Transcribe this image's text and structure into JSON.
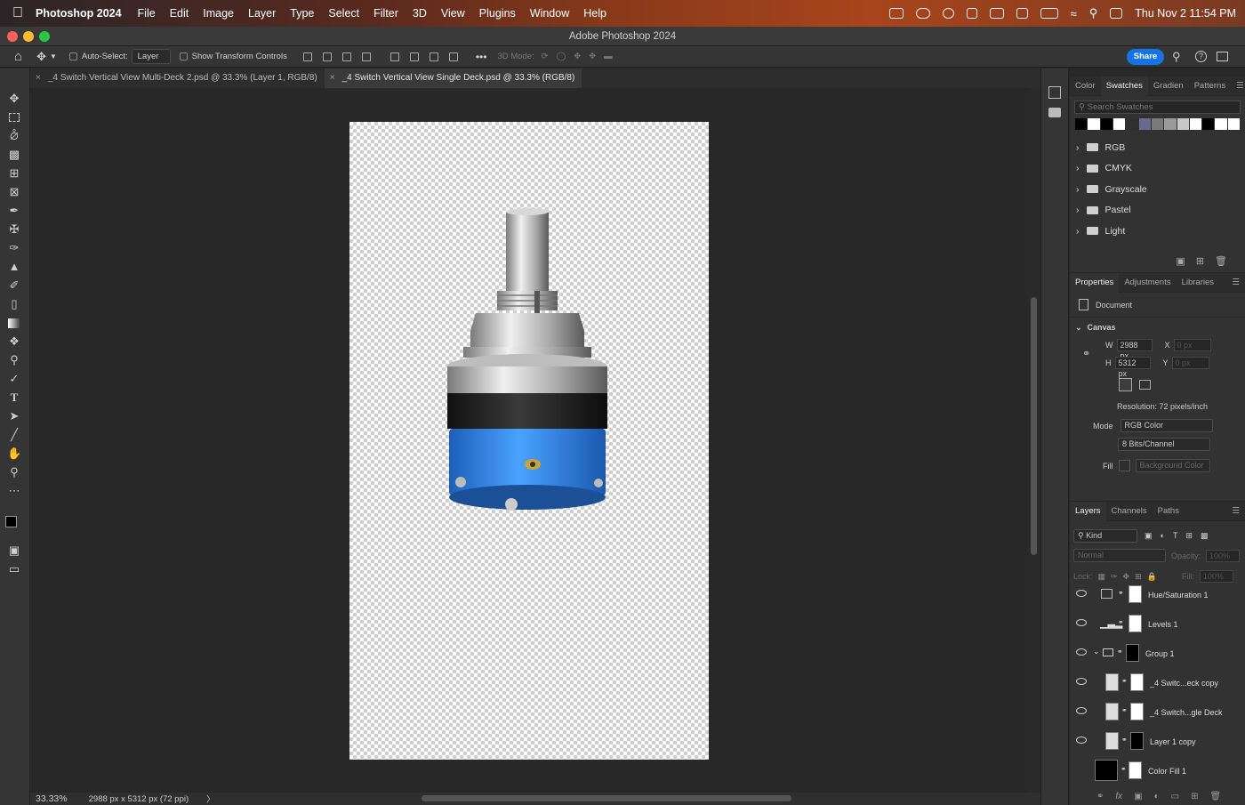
{
  "menubar": {
    "app_name": "Photoshop 2024",
    "items": [
      "File",
      "Edit",
      "Image",
      "Layer",
      "Type",
      "Select",
      "Filter",
      "3D",
      "View",
      "Plugins",
      "Window",
      "Help"
    ],
    "datetime": "Thu Nov 2  11:54 PM"
  },
  "window": {
    "title": "Adobe Photoshop 2024"
  },
  "options": {
    "auto_select_label": "Auto-Select:",
    "auto_select_value": "Layer",
    "transform_label": "Show Transform Controls",
    "mode3d_label": "3D Mode:",
    "share_label": "Share"
  },
  "tabs": [
    {
      "label": "_4 Switch Vertical View Multi-Deck 2.psd @ 33.3% (Layer 1, RGB/8)"
    },
    {
      "label": "_4 Switch Vertical View Single Deck.psd @ 33.3% (RGB/8)"
    }
  ],
  "status": {
    "zoom": "33.33%",
    "doc_info": "2988 px x 5312 px (72 ppi)",
    "arrow": "〉"
  },
  "swatches_panel": {
    "tabs": [
      "Color",
      "Swatches",
      "Gradien",
      "Patterns"
    ],
    "search_placeholder": "Search Swatches",
    "colors": [
      "#000000",
      "#ffffff",
      "#000000",
      "#ffffff",
      "#303030",
      "#6a6a90",
      "#7a7a7a",
      "#9a9a9a",
      "#c8c8c8",
      "#ffffff",
      "#000000",
      "#ffffff",
      "#ffffff"
    ],
    "folders": [
      "RGB",
      "CMYK",
      "Grayscale",
      "Pastel",
      "Light"
    ]
  },
  "properties_panel": {
    "tabs": [
      "Properties",
      "Adjustments",
      "Libraries"
    ],
    "doc_label": "Document",
    "canvas_label": "Canvas",
    "w_label": "W",
    "w_value": "2988 px",
    "h_label": "H",
    "h_value": "5312 px",
    "x_label": "X",
    "x_placeholder": "0 px",
    "y_label": "Y",
    "y_placeholder": "0 px",
    "resolution": "Resolution: 72 pixels/inch",
    "mode_label": "Mode",
    "mode_value": "RGB Color",
    "bits_value": "8 Bits/Channel",
    "fill_label": "Fill",
    "fill_value": "Background Color"
  },
  "layers_panel": {
    "tabs": [
      "Layers",
      "Channels",
      "Paths"
    ],
    "kind_label": "Kind",
    "blend_mode": "Normal",
    "opacity_label": "Opacity:",
    "opacity_value": "100%",
    "lock_label": "Lock:",
    "fill_label": "Fill:",
    "fill_value": "100%",
    "layers": [
      {
        "name": "Hue/Saturation 1"
      },
      {
        "name": "Levels 1"
      },
      {
        "name": "Group 1"
      },
      {
        "name": "_4 Switc...eck copy"
      },
      {
        "name": "_4 Switch...gle Deck"
      },
      {
        "name": "Layer 1 copy"
      },
      {
        "name": "Color Fill 1"
      }
    ]
  }
}
